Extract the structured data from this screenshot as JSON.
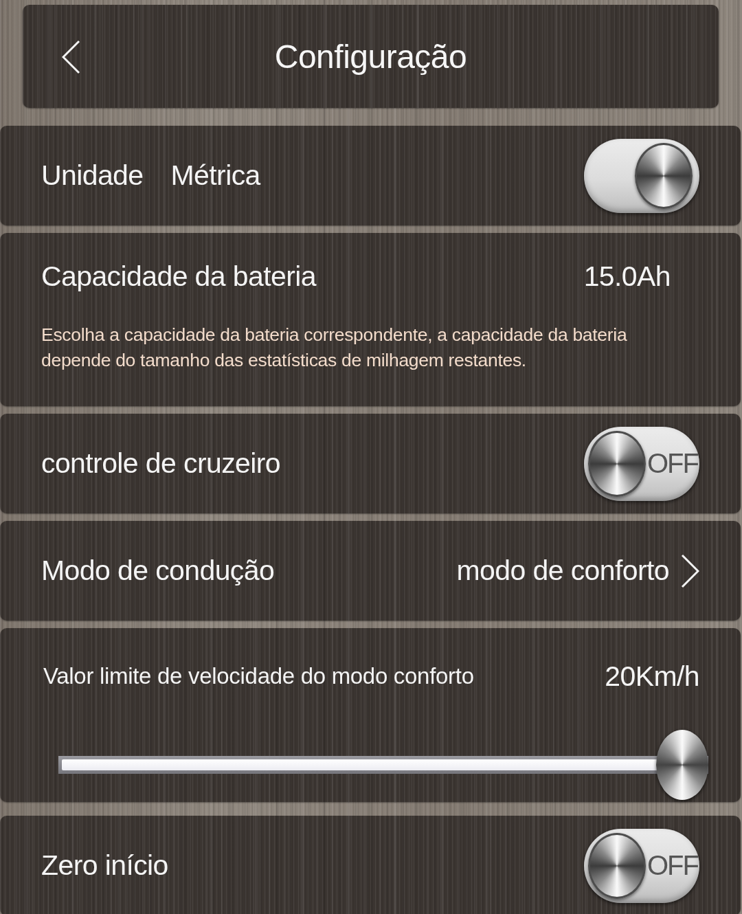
{
  "header": {
    "title": "Configuração"
  },
  "settings": [
    {
      "kind": "toggle",
      "label": "Unidade",
      "value": "Métrica",
      "toggle": {
        "on": true
      }
    },
    {
      "kind": "value",
      "label": "Capacidade da bateria",
      "value": "15.0Ah",
      "description": "Escolha a capacidade da bateria correspondente, a capacidade da bateria depende do tamanho das estatísticas de milhagem restantes."
    },
    {
      "kind": "toggle",
      "label": "controle de cruzeiro",
      "toggle": {
        "on": false,
        "text": "OFF"
      }
    },
    {
      "kind": "link",
      "label": "Modo de condução",
      "value": "modo de conforto"
    },
    {
      "kind": "slider",
      "label": "Valor limite de velocidade do modo conforto",
      "reading": "20Km/h",
      "level": 1
    },
    {
      "kind": "toggle",
      "label": "Zero início",
      "toggle": {
        "on": false,
        "text": "OFF"
      }
    }
  ]
}
